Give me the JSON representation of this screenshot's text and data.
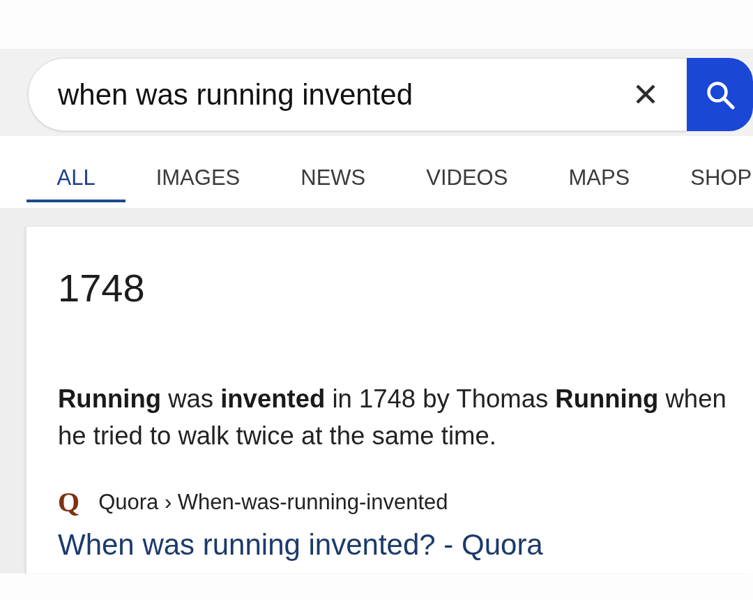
{
  "search": {
    "value": "when was running invented"
  },
  "tabs": [
    {
      "label": "ALL",
      "selected": true
    },
    {
      "label": "IMAGES",
      "selected": false
    },
    {
      "label": "NEWS",
      "selected": false
    },
    {
      "label": "VIDEOS",
      "selected": false
    },
    {
      "label": "MAPS",
      "selected": false
    },
    {
      "label": "SHOP",
      "selected": false
    }
  ],
  "answer": {
    "heading": "1748",
    "snippet": "**Running** was **invented** in 1748 by Thomas **Running** when he tried to walk twice at the same time.",
    "source": {
      "favicon": "Q",
      "breadcrumb": "Quora › When-was-running-invented"
    },
    "title": "When was running invented? - Quora"
  }
}
